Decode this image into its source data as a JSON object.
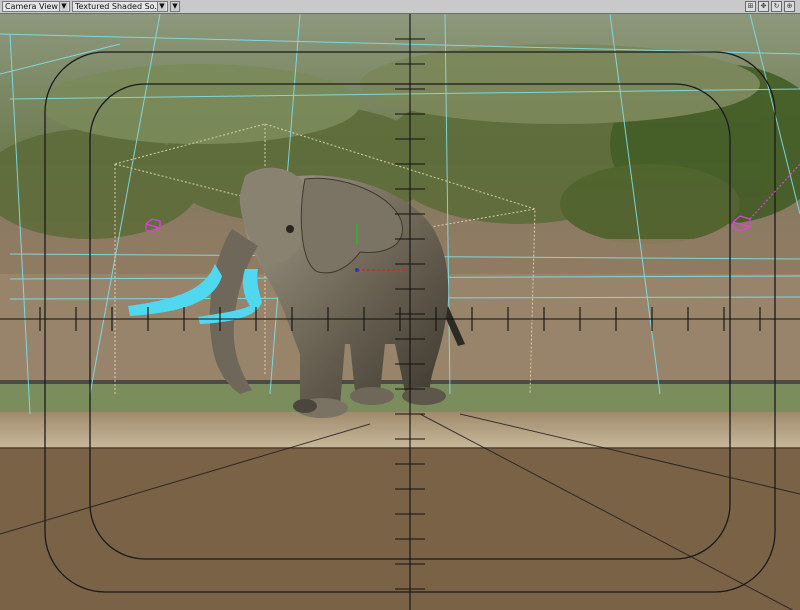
{
  "toolbar": {
    "view_label": "Camera View",
    "render_mode_label": "Textured Shaded So...",
    "dropdown_arrow": "▼",
    "viewport_buttons": [
      {
        "icon": "maximize-viewport-icon",
        "glyph": "⊞"
      },
      {
        "icon": "move-view-icon",
        "glyph": "✥"
      },
      {
        "icon": "rotate-view-icon",
        "glyph": "↻"
      },
      {
        "icon": "zoom-view-icon",
        "glyph": "⊕"
      }
    ]
  },
  "scene": {
    "subject": "elephant",
    "colors": {
      "sky": "#8c9a7a",
      "vegetation": "#5f6f3c",
      "ground": "#8a7358",
      "floor": "#7a6246",
      "grid": "#7fe0e8",
      "safe_frame": "#1a1a1a",
      "crosshair": "#111111",
      "tusk": "#4fd8f0",
      "light_marker": "#e040e0"
    }
  }
}
